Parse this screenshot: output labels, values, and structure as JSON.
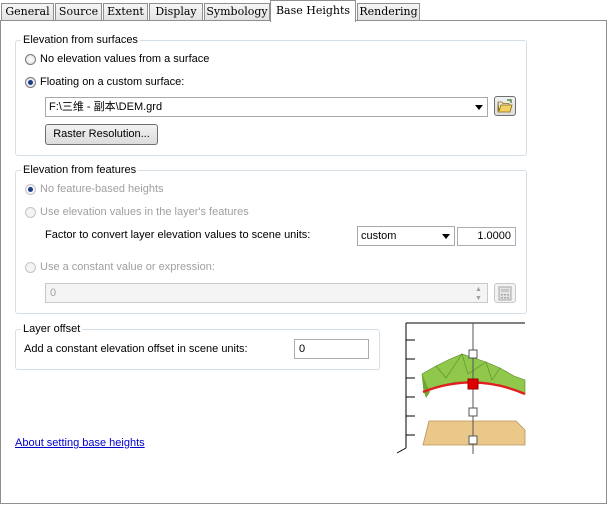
{
  "tabs": [
    "General",
    "Source",
    "Extent",
    "Display",
    "Symbology",
    "Base Heights",
    "Rendering"
  ],
  "active_tab": "Base Heights",
  "surfaces": {
    "title": "Elevation from surfaces",
    "option_none": "No elevation values from a surface",
    "option_floating": "Floating on a custom surface:",
    "surface_path": "F:\\三维 - 副本\\DEM.grd",
    "raster_button": "Raster Resolution..."
  },
  "features": {
    "title": "Elevation from features",
    "option_none": "No feature-based heights",
    "option_layer": "Use elevation values in the layer's features",
    "factor_label": "Factor to convert layer elevation values to scene units:",
    "factor_unit": "custom",
    "factor_value": "1.0000",
    "option_constant": "Use a constant value or expression:",
    "constant_value": "0"
  },
  "offset": {
    "title": "Layer offset",
    "label": "Add a constant elevation offset in scene units:",
    "value": "0"
  },
  "help_link": "About setting base heights",
  "colors": {
    "accent": "#1c3e8a",
    "link": "#0000cc",
    "surface_line": "#e02020",
    "terrain": "#8fc84a",
    "plane": "#e9c88a"
  },
  "icons": [
    "folder-open-icon",
    "calculator-icon",
    "chevron-down-icon",
    "spin-up-icon",
    "spin-down-icon"
  ]
}
